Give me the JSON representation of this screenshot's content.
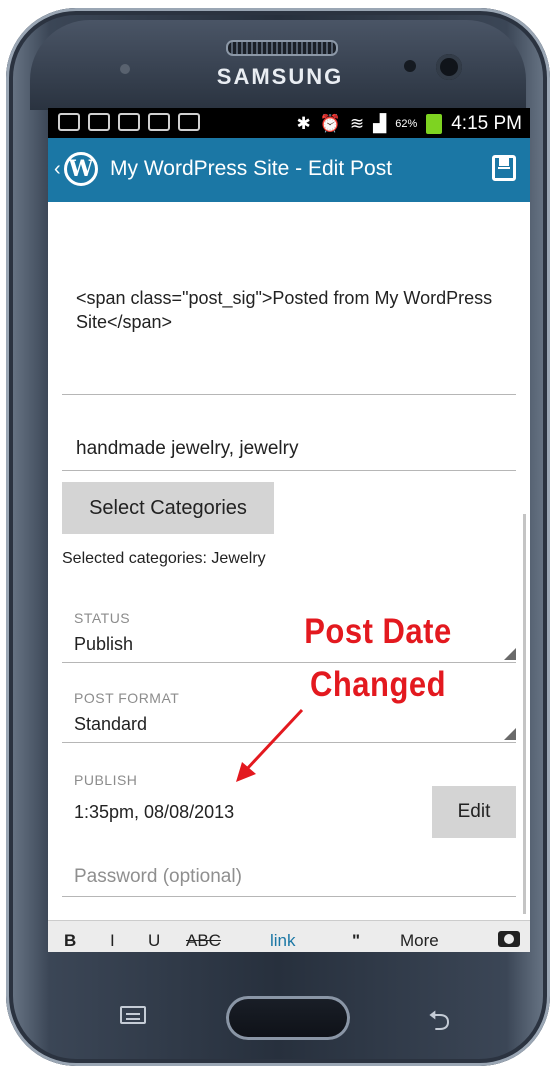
{
  "device": {
    "brand": "SAMSUNG"
  },
  "status_bar": {
    "battery": "62%",
    "time": "4:15 PM"
  },
  "action_bar": {
    "title": "My WordPress Site - Edit Post"
  },
  "post": {
    "content": "<span class=\"post_sig\">Posted from My WordPress Site</span>",
    "tags": "handmade jewelry, jewelry",
    "select_categories_label": "Select Categories",
    "selected_categories": "Selected categories: Jewelry",
    "status_label": "STATUS",
    "status_value": "Publish",
    "post_format_label": "POST FORMAT",
    "post_format_value": "Standard",
    "publish_label": "PUBLISH",
    "publish_value": "1:35pm, 08/08/2013",
    "edit_label": "Edit",
    "password_placeholder": "Password (optional)"
  },
  "format_bar": {
    "bold": "B",
    "italic": "I",
    "underline": "U",
    "strike": "ABC",
    "link": "link",
    "quote": "\"",
    "more": "More"
  },
  "annotation": {
    "line1": "Post Date",
    "line2": "Changed",
    "color": "#e3191f"
  },
  "colors": {
    "action_bar": "#1b77a5"
  }
}
